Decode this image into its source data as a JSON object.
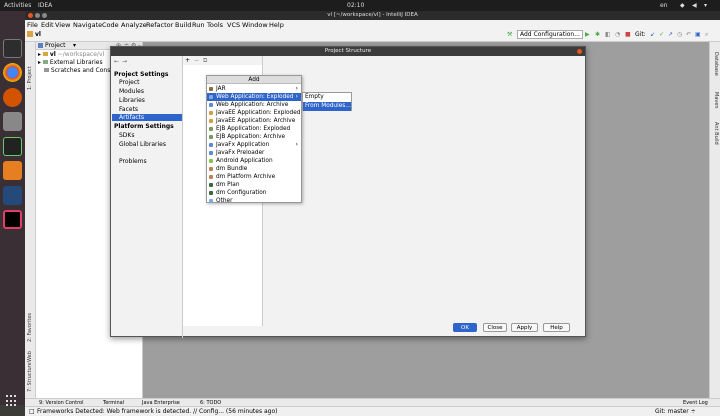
{
  "system": {
    "activities": "Activities",
    "app_name": "IDEA",
    "clock": "02:10",
    "menu_item": "en"
  },
  "window": {
    "title": "vl [~/workspace/vl] - IntelliJ IDEA"
  },
  "menu": [
    "File",
    "Edit",
    "View",
    "Navigate",
    "Code",
    "Analyze",
    "Refactor",
    "Build",
    "Run",
    "Tools",
    "VCS",
    "Window",
    "Help"
  ],
  "toolbar": {
    "breadcrumb": "vl",
    "add_config": "Add Configuration...",
    "git_label": "Git:"
  },
  "project_panel": {
    "title": "Project",
    "tree": [
      {
        "label": "vl",
        "path": "~/workspace/vl"
      },
      {
        "label": "External Libraries"
      },
      {
        "label": "Scratches and Consoles"
      }
    ]
  },
  "left_strip": {
    "project": "1: Project",
    "favorites": "2: Favorites",
    "web": "Web",
    "structure": "7: Structure"
  },
  "right_strip": {
    "database": "Database",
    "maven": "Maven",
    "ant_build": "Ant Build"
  },
  "dialog": {
    "title": "Project Structure",
    "project_settings": "Project Settings",
    "project_items": [
      "Project",
      "Modules",
      "Libraries",
      "Facets",
      "Artifacts"
    ],
    "platform_settings": "Platform Settings",
    "platform_items": [
      "SDKs",
      "Global Libraries"
    ],
    "problems": "Problems",
    "selected": "Artifacts",
    "buttons": {
      "ok": "OK",
      "close": "Close",
      "apply": "Apply",
      "help": "Help"
    }
  },
  "add_popup": {
    "header": "Add",
    "items": [
      {
        "label": "JAR",
        "submenu": true
      },
      {
        "label": "Web Application: Exploded",
        "submenu": true,
        "highlighted": true
      },
      {
        "label": "Web Application: Archive"
      },
      {
        "label": "JavaEE Application: Exploded"
      },
      {
        "label": "JavaEE Application: Archive"
      },
      {
        "label": "EJB Application: Exploded"
      },
      {
        "label": "EJB Application: Archive"
      },
      {
        "label": "JavaFx Application",
        "submenu": true
      },
      {
        "label": "JavaFx Preloader"
      },
      {
        "label": "Android Application"
      },
      {
        "label": "dm Bundle"
      },
      {
        "label": "dm Platform Archive"
      },
      {
        "label": "dm Plan"
      },
      {
        "label": "dm Configuration"
      },
      {
        "label": "Other"
      }
    ]
  },
  "submenu": {
    "items": [
      "Empty",
      "From Modules..."
    ],
    "highlighted": "From Modules..."
  },
  "bottom_tabs": [
    "9: Version Control",
    "Terminal",
    "Java Enterprise",
    "6: TODO",
    "Event Log"
  ],
  "status": {
    "message": "Frameworks Detected: Web framework is detected. // Config... (56 minutes ago)",
    "git": "Git: master ÷"
  },
  "colors": {
    "selection": "#2f65ca",
    "dock_bg": "#3b2f36",
    "ok_button": "#2f65ca"
  }
}
